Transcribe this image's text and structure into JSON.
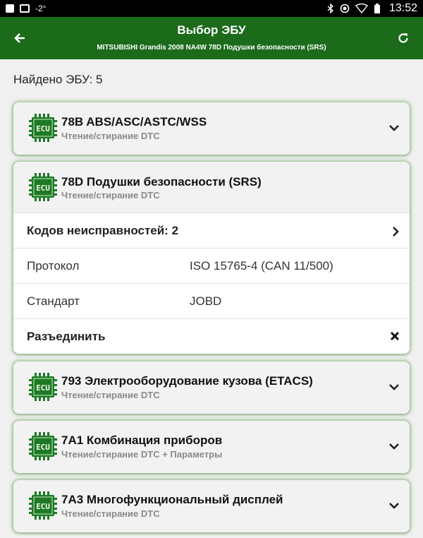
{
  "status_bar": {
    "temperature": "-2°",
    "time": "13:52"
  },
  "app_bar": {
    "title": "Выбор ЭБУ",
    "subtitle": "MITSUBISHI Grandis 2008 NA4W 78D Подушки безопасности (SRS)"
  },
  "found": "Найдено ЭБУ: 5",
  "ecu_icon_text": "ECU",
  "ecus": [
    {
      "title": "78B ABS/ASC/ASTC/WSS",
      "sub": "Чтение/стирание DTC"
    },
    {
      "title": "78D Подушки безопасности (SRS)",
      "sub": "Чтение/стирание DTC"
    },
    {
      "title": "793 Электрооборудование кузова (ETACS)",
      "sub": "Чтение/стирание DTC"
    },
    {
      "title": "7A1 Комбинация приборов",
      "sub": "Чтение/стирание DTC + Параметры"
    },
    {
      "title": "7A3 Многофункциональный дисплей",
      "sub": "Чтение/стирание DTC"
    }
  ],
  "details": {
    "dtc_count": "Кодов неисправностей: 2",
    "protocol_label": "Протокол",
    "protocol_value": "ISO 15765-4 (CAN 11/500)",
    "standard_label": "Стандарт",
    "standard_value": "JOBD",
    "disconnect": "Разъединить"
  },
  "colors": {
    "app_bar": "#1b6b1b",
    "ecu_icon": "#1d7a24",
    "card_glow": "#6caa5a"
  }
}
